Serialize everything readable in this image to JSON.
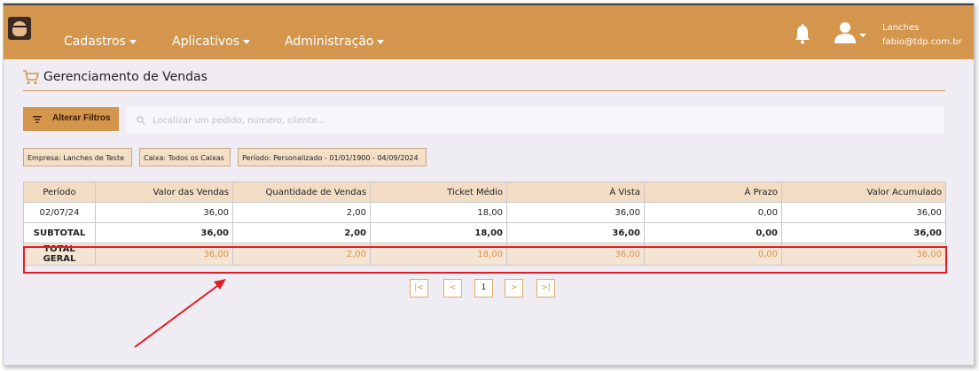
{
  "header": {
    "nav": [
      {
        "label": "Cadastros"
      },
      {
        "label": "Aplicativos"
      },
      {
        "label": "Administração"
      }
    ],
    "user": {
      "company": "Lanches",
      "email": "fabio@tdp.com.br"
    }
  },
  "page": {
    "title": "Gerenciamento de Vendas"
  },
  "toolbar": {
    "filter_label": "Alterar Filtros",
    "search_placeholder": "Localizar um pedido, número, cliente..."
  },
  "filters": [
    {
      "label": "Empresa: Lanches de Teste"
    },
    {
      "label": "Caixa: Todos os Caixas"
    },
    {
      "label": "Período: Personalizado - 01/01/1900 - 04/09/2024"
    }
  ],
  "table": {
    "headers": [
      "Período",
      "Valor das Vendas",
      "Quantidade de Vendas",
      "Ticket Médio",
      "À Vista",
      "À Prazo",
      "Valor Acumulado"
    ],
    "rows": [
      [
        "02/07/24",
        "36,00",
        "2,00",
        "18,00",
        "36,00",
        "0,00",
        "36,00"
      ]
    ],
    "subtotal": [
      "SUBTOTAL",
      "36,00",
      "2,00",
      "18,00",
      "36,00",
      "0,00",
      "36,00"
    ],
    "total": [
      "TOTAL GERAL",
      "36,00",
      "2,00",
      "18,00",
      "36,00",
      "0,00",
      "36,00"
    ]
  },
  "pagination": {
    "first": "|<",
    "prev": "<",
    "current": "1",
    "next": ">",
    "last": ">|"
  },
  "colors": {
    "brand": "#d4954d",
    "highlight": "#e31c24",
    "header_cell": "#f2dcc4",
    "total_row": "#f3e4d3"
  },
  "icons": [
    "cart-icon",
    "filter-icon",
    "search-icon",
    "bell-icon",
    "user-icon",
    "chevron-down-icon"
  ]
}
